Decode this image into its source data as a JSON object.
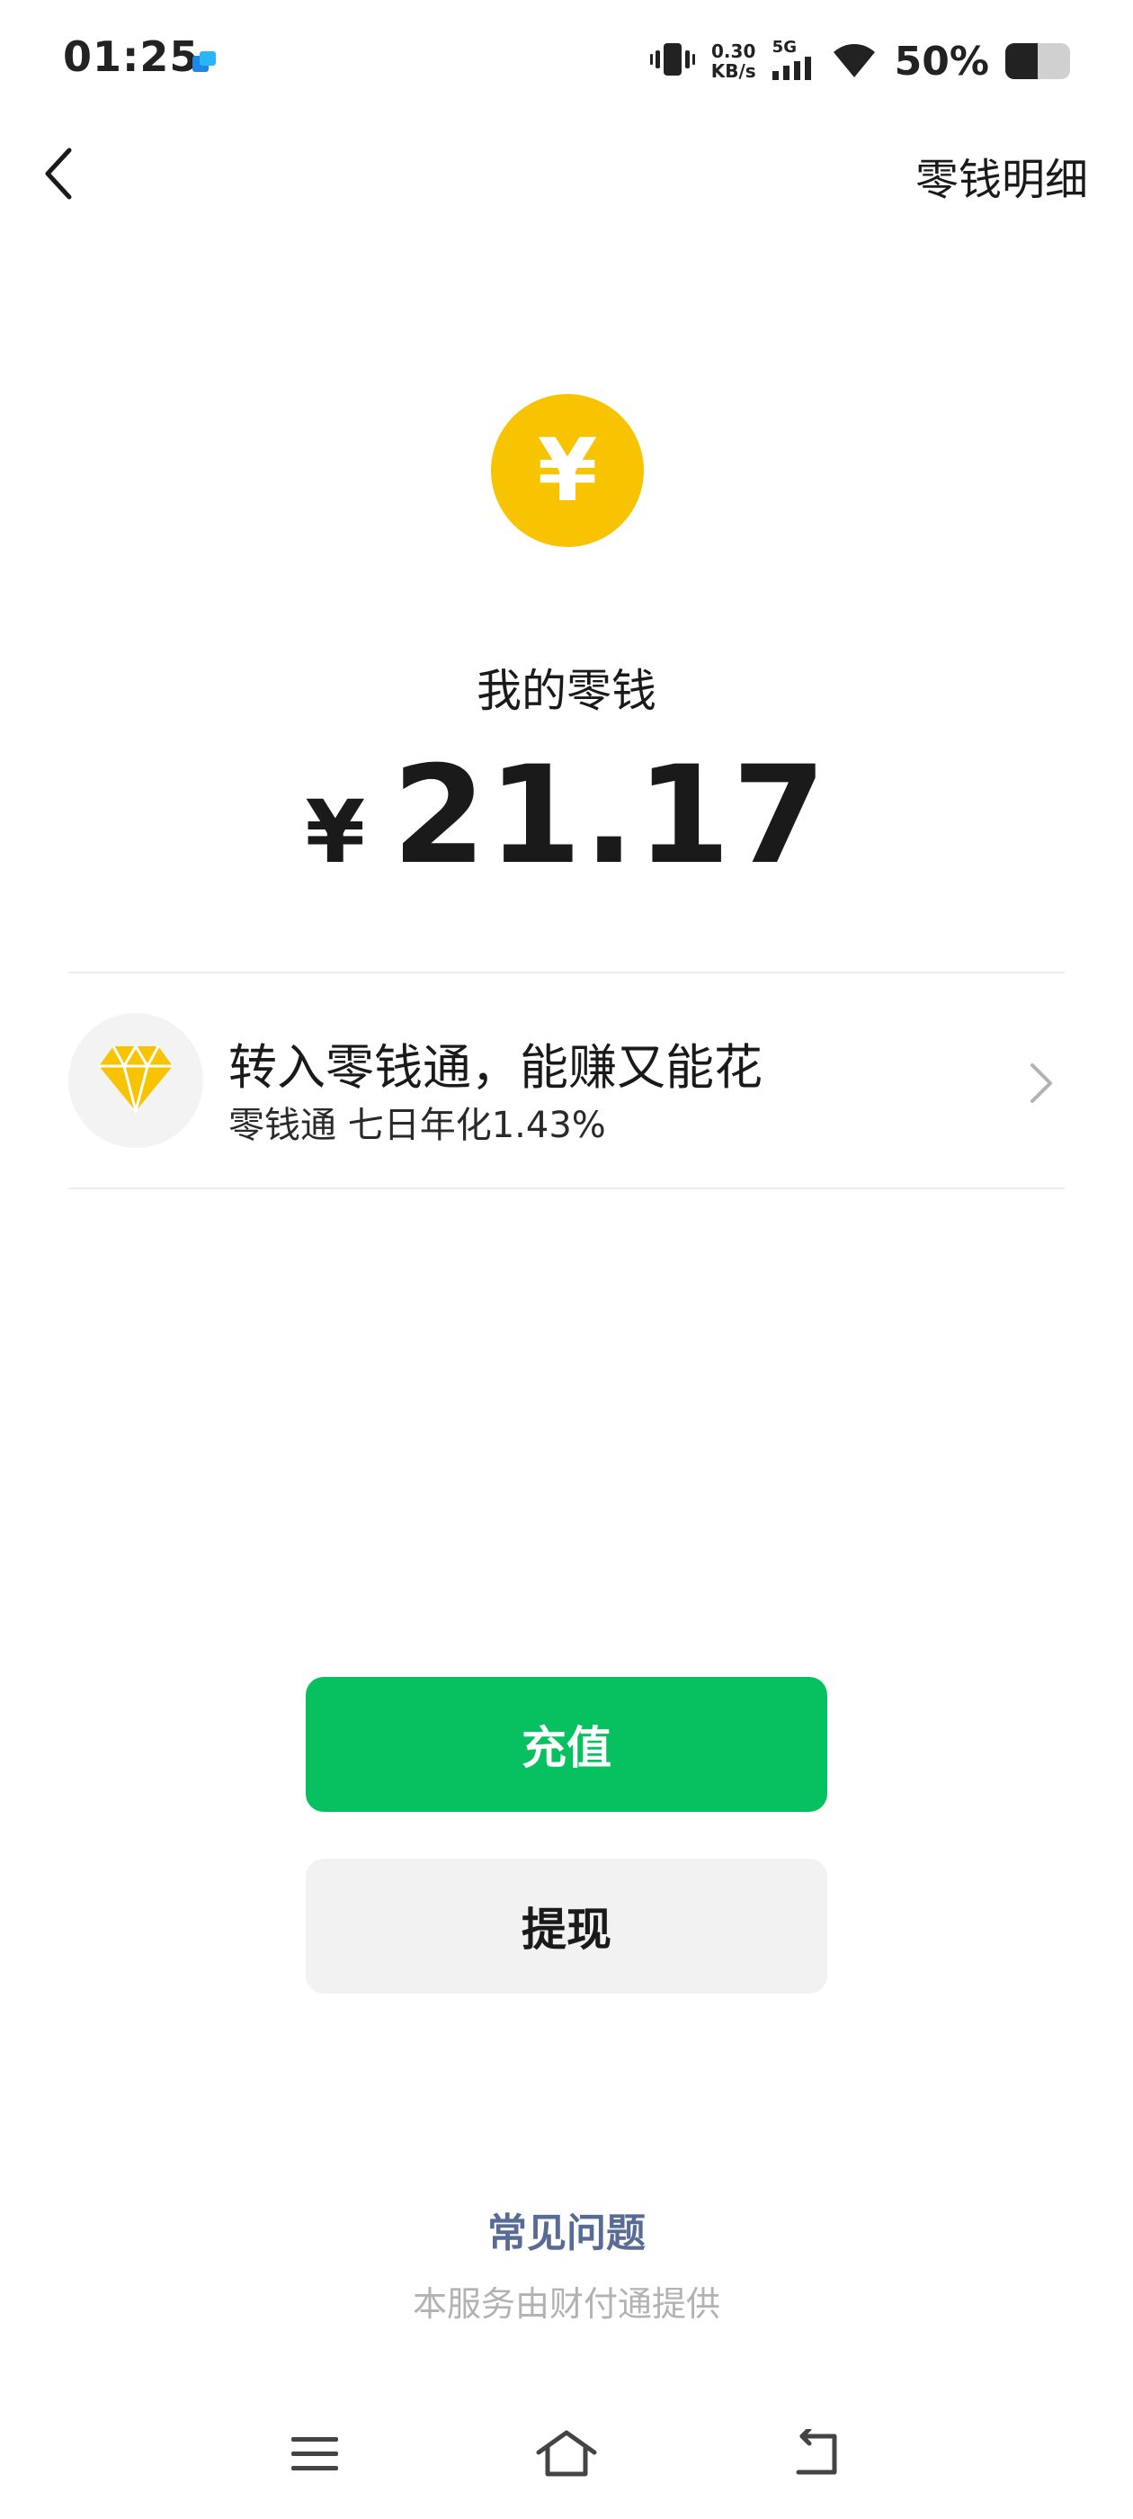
{
  "status_bar": {
    "time": "01:25",
    "net_speed_value": "0.30",
    "net_speed_unit": "KB/s",
    "network_type": "5G",
    "battery_percent": "50%",
    "battery_level": 0.5,
    "icons": [
      "app-notification-icon",
      "vibrate-icon",
      "signal-icon",
      "wifi-icon",
      "battery-icon"
    ]
  },
  "header": {
    "back_icon": "chevron-left-icon",
    "detail_link": "零钱明细"
  },
  "balance": {
    "coin_symbol": "¥",
    "label": "我的零钱",
    "currency": "¥",
    "amount": "21.17",
    "coin_color": "#f8c300"
  },
  "promo": {
    "icon": "diamond-icon",
    "title": "转入零钱通，能赚又能花",
    "subtitle": "零钱通 七日年化1.43%",
    "chevron_icon": "chevron-right-icon"
  },
  "actions": {
    "recharge_label": "充值",
    "withdraw_label": "提现",
    "accent_color": "#07c160"
  },
  "footer": {
    "faq": "常见问题",
    "provider_note": "本服务由财付通提供",
    "link_color": "#576b95"
  },
  "navbar": {
    "icons": [
      "menu-icon",
      "home-icon",
      "back-icon"
    ]
  }
}
